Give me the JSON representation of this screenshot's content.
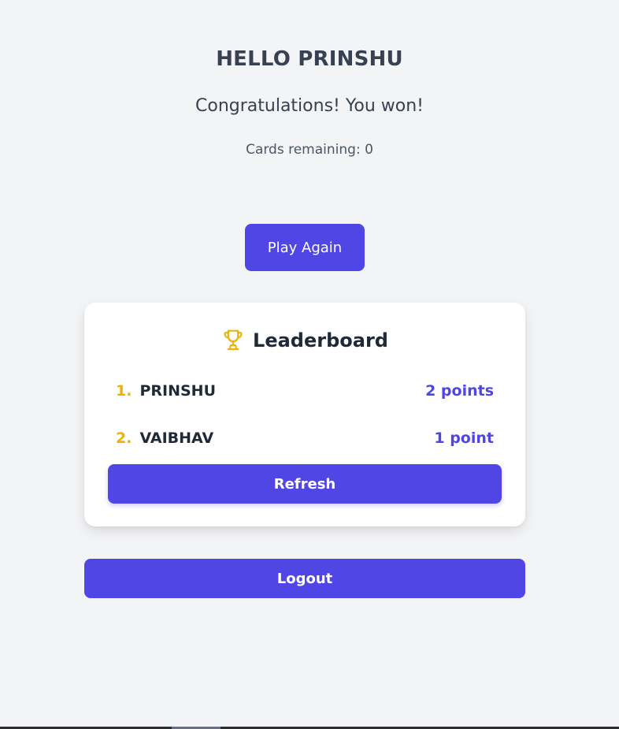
{
  "header": {
    "greeting": "HELLO PRINSHU",
    "status_message": "Congratulations! You won!",
    "cards_remaining_label": "Cards remaining:",
    "cards_remaining_value": "0"
  },
  "actions": {
    "play_again_label": "Play Again",
    "logout_label": "Logout"
  },
  "leaderboard": {
    "title": "Leaderboard",
    "icon": "trophy-icon",
    "entries": [
      {
        "rank": "1.",
        "name": "PRINSHU",
        "points": "2 points"
      },
      {
        "rank": "2.",
        "name": "VAIBHAV",
        "points": "1 point"
      }
    ],
    "refresh_label": "Refresh"
  },
  "colors": {
    "background": "#f3f4f6",
    "primary": "#4f46e5",
    "rank": "#eab308",
    "text_dark": "#1f2937"
  }
}
